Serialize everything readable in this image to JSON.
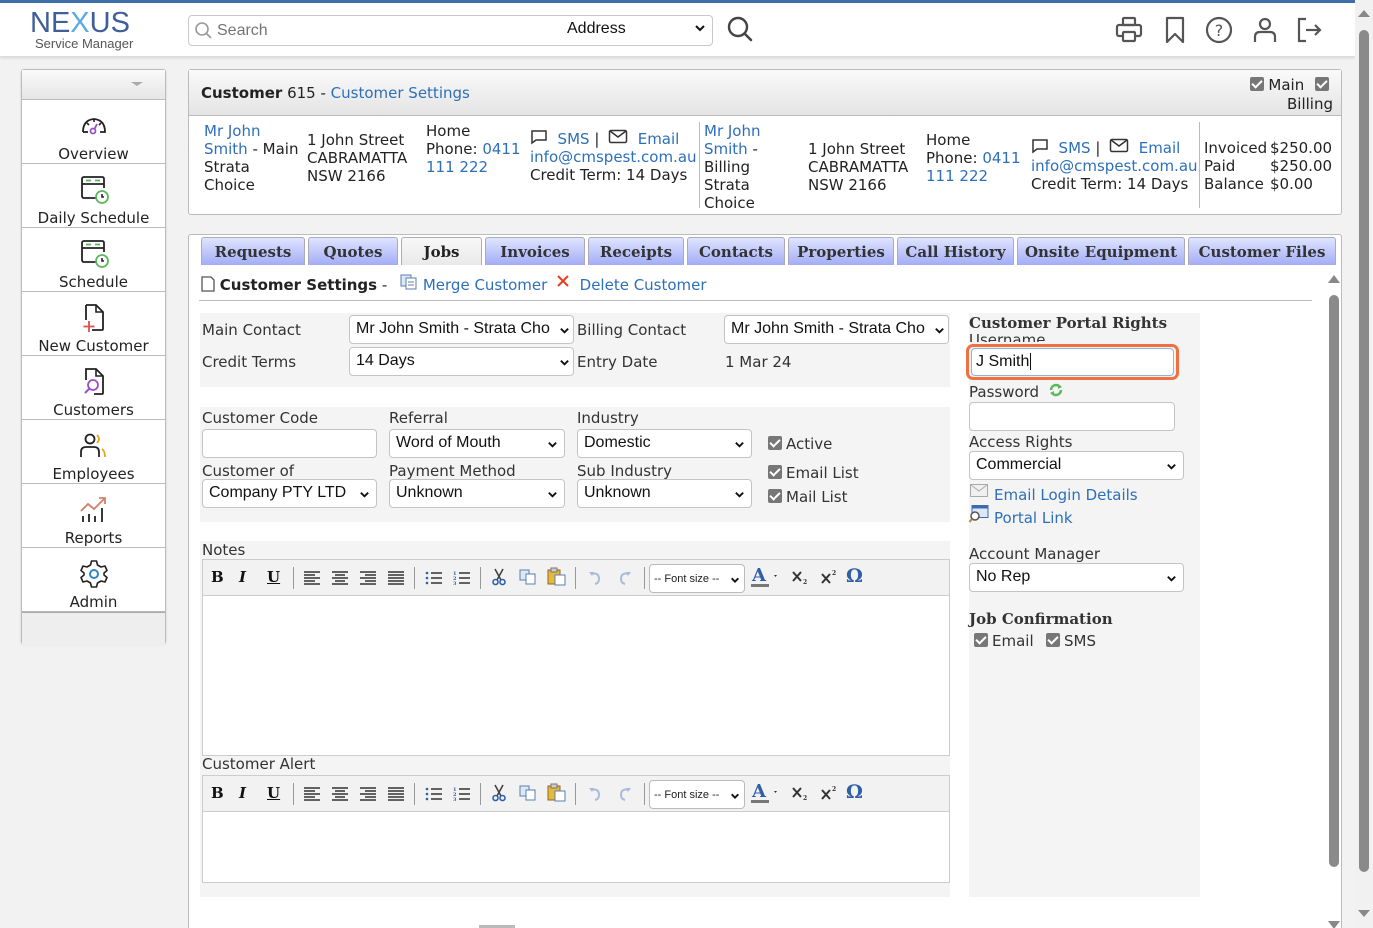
{
  "app": {
    "logo_main": "NEXUS",
    "logo_sub": "Service Manager"
  },
  "header": {
    "search_placeholder": "Search",
    "search_scope": "Address",
    "icons": [
      "search-icon",
      "print-icon",
      "bookmark-icon",
      "help-icon",
      "user-icon",
      "logout-icon"
    ]
  },
  "sidebar": {
    "items": [
      {
        "label": "Overview",
        "icon": "gauge-icon"
      },
      {
        "label": "Daily Schedule",
        "icon": "calendar-clock-icon"
      },
      {
        "label": "Schedule",
        "icon": "calendar-clock-icon"
      },
      {
        "label": "New Customer",
        "icon": "new-document-icon"
      },
      {
        "label": "Customers",
        "icon": "document-search-icon"
      },
      {
        "label": "Employees",
        "icon": "people-icon"
      },
      {
        "label": "Reports",
        "icon": "chart-icon"
      },
      {
        "label": "Admin",
        "icon": "gear-icon"
      }
    ]
  },
  "customer": {
    "title_bold": "Customer",
    "number": "615 -",
    "settings_link": "Customer Settings",
    "flag_main": "Main",
    "flag_billing": "Billing",
    "main_contact": {
      "name_line1": "Mr John",
      "name_line2": "Smith",
      "role": " - Main",
      "company_line1": "Strata",
      "company_line2": "Choice",
      "address1": "1 John Street",
      "address2": "CABRAMATTA",
      "address3": "NSW 2166",
      "phone_label1": "Home",
      "phone_label2": "Phone:",
      "phone1": "0411",
      "phone2": "111 222",
      "sms": "SMS",
      "sep": "|",
      "email": "Email",
      "email_address": "info@cmspest.com.au",
      "credit_term": "Credit Term: 14 Days"
    },
    "billing_contact": {
      "name_line1": "Mr John",
      "name_line2": "Smith",
      "role": " -",
      "role2": "Billing",
      "company_line1": "Strata",
      "company_line2": "Choice",
      "address1": "1 John Street",
      "address2": "CABRAMATTA",
      "address3": "NSW 2166",
      "phone_label1": "Home",
      "phone_label2": "Phone:",
      "phone1": "0411",
      "phone2": "111 222",
      "sms": "SMS",
      "sep": "|",
      "email": "Email",
      "email_address": "info@cmspest.com.au",
      "credit_term": "Credit Term: 14 Days"
    },
    "balances": [
      {
        "label": "Invoiced",
        "value": "$250.00"
      },
      {
        "label": "Paid",
        "value": "$250.00"
      },
      {
        "label": "Balance",
        "value": "$0.00"
      }
    ]
  },
  "tabs": [
    {
      "label": "Requests"
    },
    {
      "label": "Quotes"
    },
    {
      "label": "Jobs",
      "active": true
    },
    {
      "label": "Invoices"
    },
    {
      "label": "Receipts"
    },
    {
      "label": "Contacts"
    },
    {
      "label": "Properties"
    },
    {
      "label": "Call History"
    },
    {
      "label": "Onsite Equipment"
    },
    {
      "label": "Customer Files"
    }
  ],
  "settings": {
    "title": "Customer Settings",
    "title_sep": " -",
    "merge": "Merge Customer",
    "delete": "Delete Customer",
    "main_contact_label": "Main Contact",
    "main_contact_value": "Mr John Smith - Strata Cho",
    "billing_contact_label": "Billing Contact",
    "billing_contact_value": "Mr John Smith - Strata Cho",
    "credit_terms_label": "Credit Terms",
    "credit_terms_value": "14 Days",
    "entry_date_label": "Entry Date",
    "entry_date_value": "1 Mar 24",
    "customer_code_label": "Customer Code",
    "customer_code_value": "",
    "referral_label": "Referral",
    "referral_value": "Word of Mouth",
    "industry_label": "Industry",
    "industry_value": "Domestic",
    "customer_of_label": "Customer of",
    "customer_of_value": "Company PTY LTD",
    "payment_method_label": "Payment Method",
    "payment_method_value": "Unknown",
    "sub_industry_label": "Sub Industry",
    "sub_industry_value": "Unknown",
    "active_label": "Active",
    "active_checked": true,
    "email_list_label": "Email List",
    "email_list_checked": true,
    "mail_list_label": "Mail List",
    "mail_list_checked": true,
    "notes_label": "Notes",
    "notes_value": "",
    "alert_label": "Customer Alert",
    "alert_value": "",
    "font_size_placeholder": "-- Font size --"
  },
  "portal": {
    "title": "Customer Portal Rights",
    "username_label": "Username",
    "username_value": "J Smith",
    "password_label": "Password",
    "password_value": "",
    "access_rights_label": "Access Rights",
    "access_rights_value": "Commercial",
    "email_login": "Email Login Details",
    "portal_link": "Portal Link",
    "account_manager_label": "Account Manager",
    "account_manager_value": "No Rep",
    "job_confirmation_title": "Job Confirmation",
    "jc_email_label": "Email",
    "jc_email_checked": true,
    "jc_sms_label": "SMS",
    "jc_sms_checked": true
  },
  "colors": {
    "accent": "#2e6fba",
    "focus_ring": "#f07040",
    "tab_blue": "#9ea9f5",
    "brand": "#3f5f9a"
  }
}
